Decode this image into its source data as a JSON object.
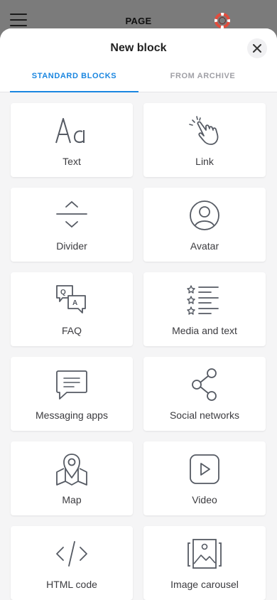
{
  "topbar": {
    "title": "PAGE",
    "menu_icon": "hamburger-menu-icon",
    "help_icon": "lifebuoy-icon",
    "help_icon_color": "#e24c3c"
  },
  "sheet": {
    "title": "New block",
    "close_icon": "close-icon",
    "tabs": [
      {
        "label": "STANDARD BLOCKS",
        "active": true
      },
      {
        "label": "FROM ARCHIVE",
        "active": false
      }
    ],
    "accent_color": "#1a86e0"
  },
  "blocks": [
    {
      "label": "Text",
      "icon": "text-icon"
    },
    {
      "label": "Link",
      "icon": "pointer-hand-icon"
    },
    {
      "label": "Divider",
      "icon": "divider-icon"
    },
    {
      "label": "Avatar",
      "icon": "avatar-icon"
    },
    {
      "label": "FAQ",
      "icon": "faq-icon"
    },
    {
      "label": "Media and text",
      "icon": "media-list-icon"
    },
    {
      "label": "Messaging apps",
      "icon": "chat-bubble-icon"
    },
    {
      "label": "Social networks",
      "icon": "share-icon"
    },
    {
      "label": "Map",
      "icon": "map-pin-icon"
    },
    {
      "label": "Video",
      "icon": "play-icon"
    },
    {
      "label": "HTML code",
      "icon": "code-icon"
    },
    {
      "label": "Image carousel",
      "icon": "image-carousel-icon"
    }
  ]
}
